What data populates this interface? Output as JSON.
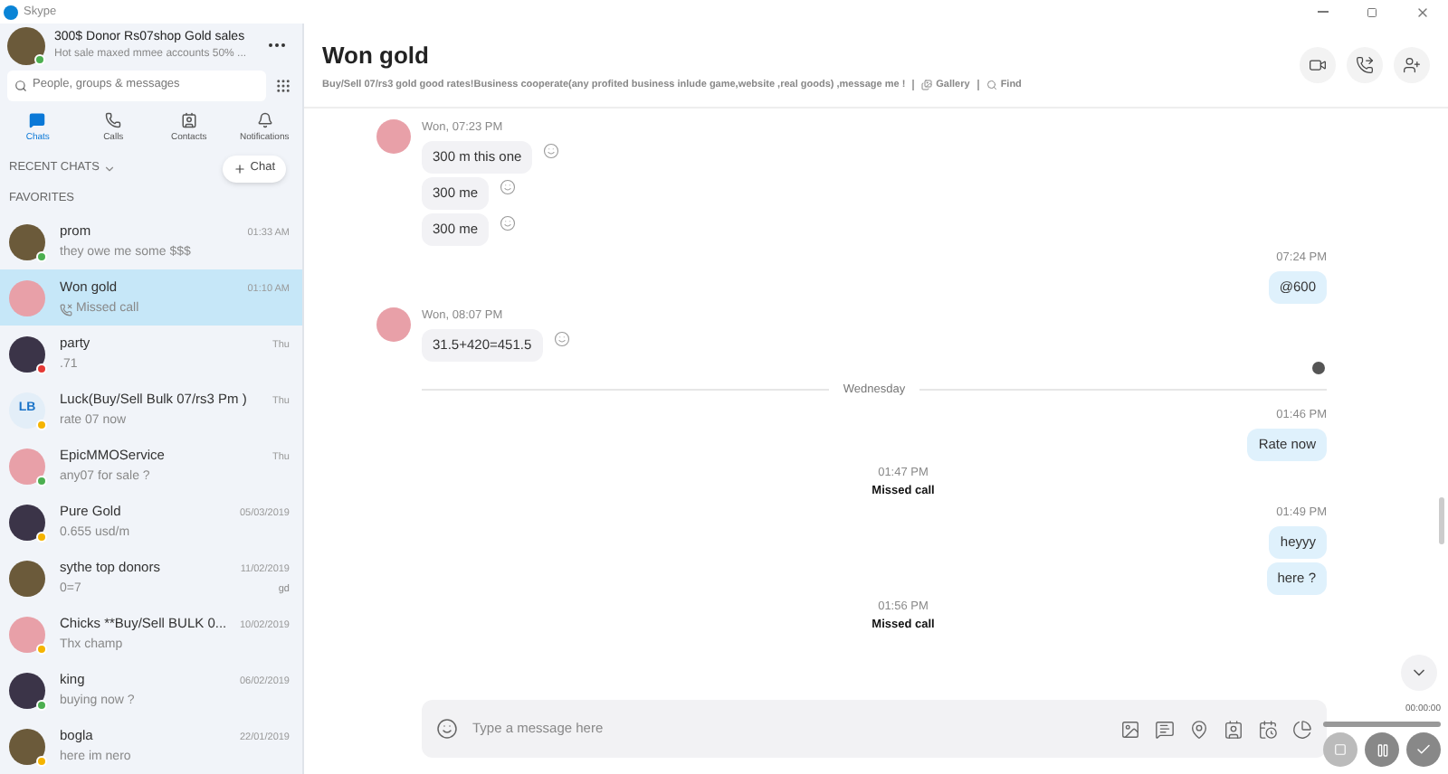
{
  "window": {
    "title": "Skype"
  },
  "profile": {
    "name": "300$ Donor Rs07shop  Gold sales",
    "mood": "Hot sale maxed mmee accounts 50% ...",
    "color": "#4caf50"
  },
  "search": {
    "placeholder": "People, groups & messages"
  },
  "nav_tabs": [
    {
      "label": "Chats",
      "kind": "chats",
      "selected": true
    },
    {
      "label": "Calls",
      "kind": "calls",
      "selected": false
    },
    {
      "label": "Contacts",
      "kind": "contacts",
      "selected": false
    },
    {
      "label": "Notifications",
      "kind": "notifications",
      "selected": false
    }
  ],
  "recent_chats_label": "RECENT CHATS",
  "new_chat_button": "Chat",
  "favorites_label": "FAVORITES",
  "chats": [
    {
      "name": "prom",
      "preview": "they owe me some $$$",
      "time": "01:33 AM",
      "selected": false,
      "color": "#4caf50"
    },
    {
      "name": "Won gold",
      "preview": "Missed call",
      "kind": "missed_call",
      "time": "01:10 AM",
      "selected": true
    },
    {
      "name": "party",
      "preview": ".71",
      "time": "Thu",
      "selected": false,
      "color": "#e53935"
    },
    {
      "name": "Luck(Buy/Sell Bulk 07/rs3 Pm )",
      "initials": "LB",
      "preview": "rate 07 now",
      "time": "Thu",
      "selected": false,
      "color": "#f5b400"
    },
    {
      "name": "EpicMMOService",
      "preview": "any07 for sale ?",
      "time": "Thu",
      "selected": false,
      "color": "#4caf50"
    },
    {
      "name": "Pure Gold",
      "preview": "0.655 usd/m",
      "time": "05/03/2019",
      "selected": false,
      "color": "#f5b400"
    },
    {
      "name": "sythe top donors",
      "preview": "0=7",
      "time": "11/02/2019",
      "extra": "gd",
      "selected": false
    },
    {
      "name": "Chicks **Buy/Sell BULK 0...",
      "preview": "Thx champ",
      "time": "10/02/2019",
      "selected": false,
      "color": "#f5b400"
    },
    {
      "name": "king",
      "preview": "buying now ?",
      "time": "06/02/2019",
      "selected": false,
      "color": "#4caf50"
    },
    {
      "name": "bogla",
      "preview": "here im nero",
      "time": "22/01/2019",
      "selected": false,
      "color": "#f5b400"
    }
  ],
  "conversation": {
    "title": "Won gold",
    "description": "Buy/Sell 07/rs3 gold good rates!Business cooperate(any profited business inlude game,website ,real goods) ,message me ! ",
    "gallery": "Gallery",
    "find": "Find"
  },
  "messages": [
    {
      "kind": "incoming",
      "time": "Won, 07:23 PM",
      "texts": [
        "300 m this one",
        "300 me",
        "300 me"
      ]
    },
    {
      "kind": "outgoing",
      "time": "07:24 PM",
      "texts": [
        "@600"
      ]
    },
    {
      "kind": "incoming",
      "time": "Won, 08:07 PM",
      "texts": [
        "31.5+420=451.5"
      ],
      "read_receipt": true
    },
    {
      "kind": "divider",
      "text": "Wednesday"
    },
    {
      "kind": "outgoing",
      "time": "01:46 PM",
      "texts": [
        "Rate now"
      ]
    },
    {
      "kind": "call",
      "time": "01:47 PM",
      "text": "Missed call"
    },
    {
      "kind": "outgoing",
      "time": "01:49 PM",
      "texts": [
        "heyyy",
        "here ?"
      ]
    },
    {
      "kind": "call",
      "time": "01:56 PM",
      "text": "Missed call"
    }
  ],
  "composer": {
    "placeholder": "Type a message here"
  },
  "recorder": {
    "timer": "00:00:00"
  }
}
